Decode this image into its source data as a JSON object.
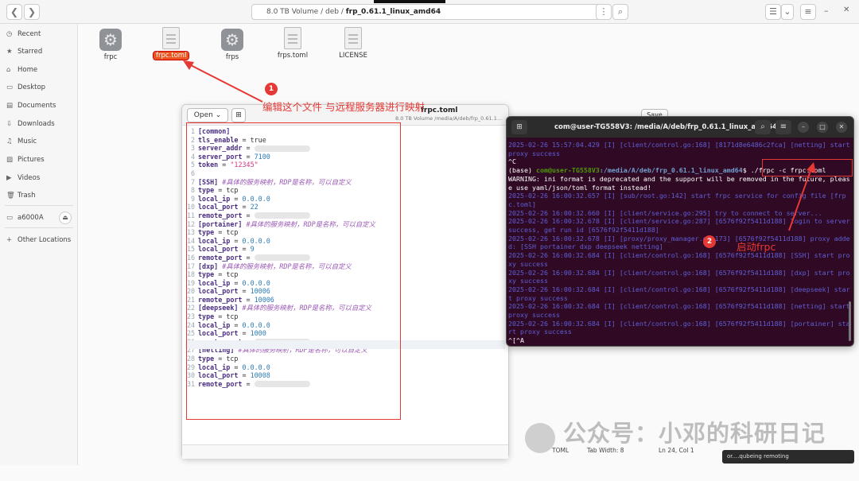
{
  "header": {
    "path_root": "8.0 TB Volume",
    "path_sep1": "/",
    "path_mid": "deb",
    "path_sep2": "/",
    "path_current": "frp_0.61.1_linux_amd64",
    "back_glyph": "❮",
    "forward_glyph": "❯",
    "menu_glyph": "⋮",
    "search_glyph": "⌕",
    "list_glyph": "☰",
    "dropdown_glyph": "⌄",
    "hamburger_glyph": "≡",
    "minimize_glyph": "–",
    "close_glyph": "✕"
  },
  "sidebar": {
    "items": [
      {
        "icon": "◷",
        "label": "Recent"
      },
      {
        "icon": "★",
        "label": "Starred"
      },
      {
        "icon": "⌂",
        "label": "Home"
      },
      {
        "icon": "▭",
        "label": "Desktop"
      },
      {
        "icon": "▤",
        "label": "Documents"
      },
      {
        "icon": "⇩",
        "label": "Downloads"
      },
      {
        "icon": "♫",
        "label": "Music"
      },
      {
        "icon": "▨",
        "label": "Pictures"
      },
      {
        "icon": "▶",
        "label": "Videos"
      },
      {
        "icon": "🗑",
        "label": "Trash"
      },
      {
        "icon": "▭",
        "label": "a6000A"
      },
      {
        "icon": "+",
        "label": "Other Locations"
      }
    ],
    "eject_glyph": "⏏"
  },
  "files": [
    {
      "name": "frpc",
      "kind": "executable"
    },
    {
      "name": "frpc.toml",
      "kind": "text",
      "selected": true
    },
    {
      "name": "frps",
      "kind": "executable"
    },
    {
      "name": "frps.toml",
      "kind": "text"
    },
    {
      "name": "LICENSE",
      "kind": "text"
    }
  ],
  "editor": {
    "open_label": "Open",
    "open_chevron": "⌄",
    "new_tab_glyph": "⊞",
    "title": "frpc.toml",
    "subtitle": "8.0 TB Volume /media/A/deb/frp_0.61.1...",
    "save_label": "Save",
    "status_lang": "TOML",
    "status_tab": "Tab Width: 8",
    "status_pos": "Ln 24, Col 1"
  },
  "code": [
    {
      "n": "1",
      "t": "[common]"
    },
    {
      "n": "2",
      "t": "tls_enable = true"
    },
    {
      "n": "3",
      "t": "server_addr = "
    },
    {
      "n": "4",
      "t": "server_port = 7100"
    },
    {
      "n": "5",
      "t": "token = \"12345\""
    },
    {
      "n": "6",
      "t": ""
    },
    {
      "n": "7",
      "t": "[SSH] #具体的服务映射，RDP是名称，可以自定义"
    },
    {
      "n": "8",
      "t": "type = tcp"
    },
    {
      "n": "9",
      "t": "local_ip = 0.0.0.0"
    },
    {
      "n": "10",
      "t": "local_port = 22"
    },
    {
      "n": "11",
      "t": "remote_port = "
    },
    {
      "n": "12",
      "t": "[portainer] #具体的服务映射，RDP是名称，可以自定义"
    },
    {
      "n": "13",
      "t": "type = tcp"
    },
    {
      "n": "14",
      "t": "local_ip = 0.0.0.0"
    },
    {
      "n": "15",
      "t": "local_port = 9"
    },
    {
      "n": "16",
      "t": "remote_port = "
    },
    {
      "n": "17",
      "t": "[dxp] #具体的服务映射，RDP是名称，可以自定义"
    },
    {
      "n": "18",
      "t": "type = tcp"
    },
    {
      "n": "19",
      "t": "local_ip = 0.0.0.0"
    },
    {
      "n": "20",
      "t": "local_port = 10006"
    },
    {
      "n": "21",
      "t": "remote_port = 10006"
    },
    {
      "n": "22",
      "t": "[deepseek] #具体的服务映射，RDP是名称，可以自定义"
    },
    {
      "n": "23",
      "t": "type = tcp"
    },
    {
      "n": "24",
      "t": "local_ip = 0.0.0.0"
    },
    {
      "n": "25",
      "t": "local_port = 1000"
    },
    {
      "n": "26",
      "t": "remote_port = "
    },
    {
      "n": "27",
      "t": "[netting] #具体的服务映射，RDP是名称，可以自定义"
    },
    {
      "n": "28",
      "t": "type = tcp"
    },
    {
      "n": "29",
      "t": "local_ip = 0.0.0.0"
    },
    {
      "n": "30",
      "t": "local_port = 10008"
    },
    {
      "n": "31",
      "t": "remote_port = "
    }
  ],
  "terminal": {
    "title": "com@user-TG558V3: /media/A/deb/frp_0.61.1_linux_amd64",
    "newtab_glyph": "⊞",
    "search_glyph": "⌕",
    "menu_glyph": "≡",
    "min_glyph": "–",
    "max_glyph": "□",
    "close_glyph": "✕",
    "lines": [
      {
        "c": "log",
        "t": "2025-02-26 15:57:04.429 [I] [client/control.go:168] [8171d8e6486c2fca] [netting] start proxy success"
      },
      {
        "c": "white",
        "t": "^C"
      },
      {
        "c": "prompt",
        "env": "(base) ",
        "user": "com@user-TG558V3",
        "path": ":/media/A/deb/frp_0.61.1_linux_amd64",
        "cmd": "$ ./frpc -c frpc.toml"
      },
      {
        "c": "white",
        "t": "WARNING: ini format is deprecated and the support will be removed in the future, please use yaml/json/toml format instead!"
      },
      {
        "c": "log",
        "t": "2025-02-26 16:00:32.657 [I] [sub/root.go:142] start frpc service for config file [frpc.toml]"
      },
      {
        "c": "log",
        "t": "2025-02-26 16:00:32.660 [I] [client/service.go:295] try to connect to server..."
      },
      {
        "c": "log",
        "t": "2025-02-26 16:00:32.678 [I] [client/service.go:287] [6576f92f5411d188] login to server success, get run id [6576f92f5411d188]"
      },
      {
        "c": "log",
        "t": "2025-02-26 16:00:32.678 [I] [proxy/proxy_manager.go:173] [6576f92f5411d188] proxy added: [SSH portainer dxp deepseek netting]"
      },
      {
        "c": "log",
        "t": "2025-02-26 16:00:32.684 [I] [client/control.go:168] [6576f92f5411d188] [SSH] start proxy success"
      },
      {
        "c": "log",
        "t": "2025-02-26 16:00:32.684 [I] [client/control.go:168] [6576f92f5411d188] [dxp] start proxy success"
      },
      {
        "c": "log",
        "t": "2025-02-26 16:00:32.684 [I] [client/control.go:168] [6576f92f5411d188] [deepseek] start proxy success"
      },
      {
        "c": "log",
        "t": "2025-02-26 16:00:32.684 [I] [client/control.go:168] [6576f92f5411d188] [netting] start proxy success"
      },
      {
        "c": "log",
        "t": "2025-02-26 16:00:32.684 [I] [client/control.go:168] [6576f92f5411d188] [portainer] start proxy success"
      },
      {
        "c": "white",
        "t": "^[^A"
      }
    ]
  },
  "annotations": {
    "step1_num": "1",
    "step1_text": "编辑这个文件 与远程服务器进行映射",
    "step2_num": "2",
    "step2_text": "启动frpc"
  },
  "watermark": "公众号：小邓的科研日记",
  "notification": "or....qubeing remoting",
  "colors": {
    "accent": "#e95420",
    "annotation": "#e53935",
    "terminal_bg": "#300a24"
  }
}
